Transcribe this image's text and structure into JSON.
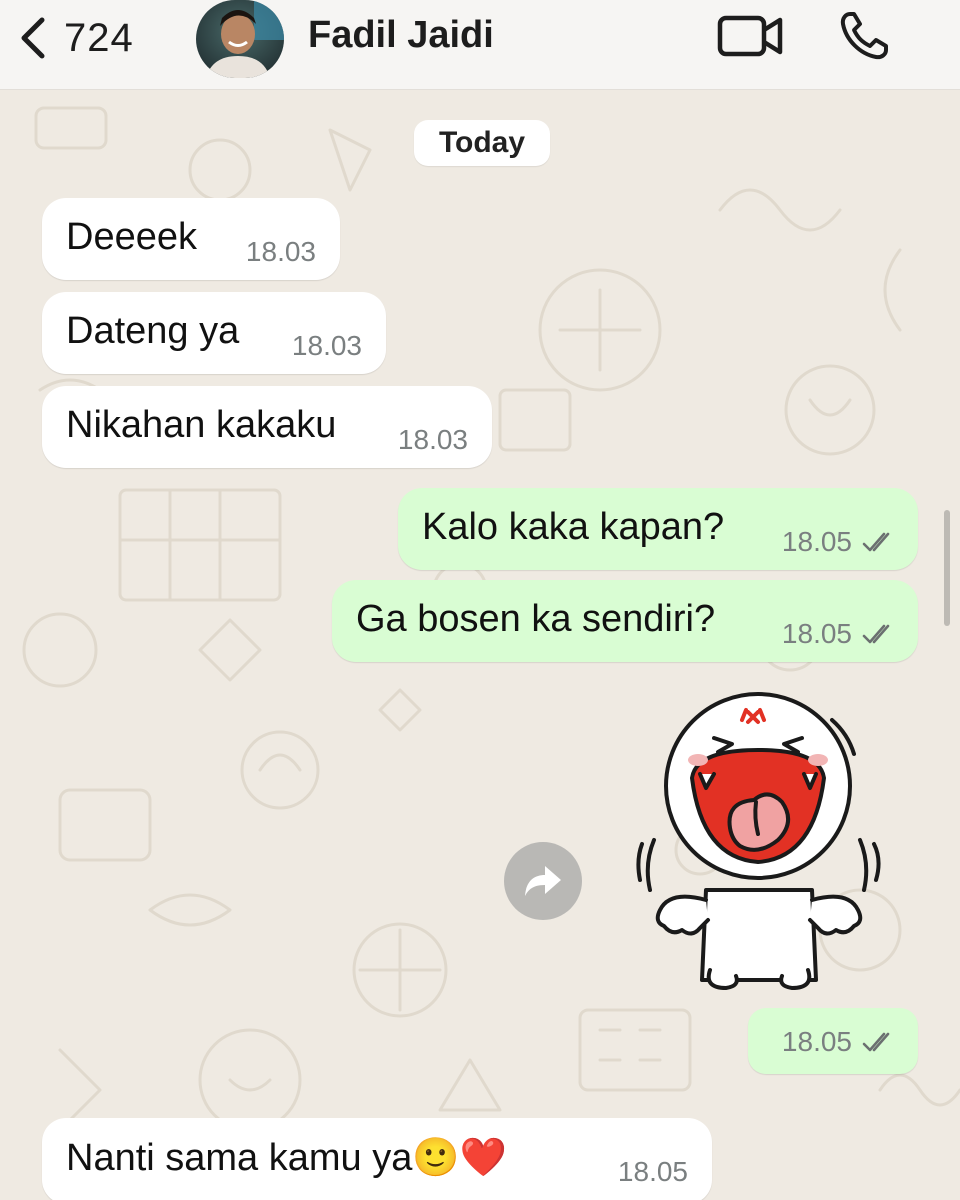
{
  "header": {
    "back_count": "724",
    "contact_name": "Fadil Jaidi",
    "icons": [
      "chevron-left-icon",
      "video-camera-icon",
      "phone-icon"
    ]
  },
  "chat": {
    "date_chip": "Today",
    "messages": [
      {
        "direction": "in",
        "text": "Deeeek",
        "time": "18.03"
      },
      {
        "direction": "in",
        "text": "Dateng ya",
        "time": "18.03"
      },
      {
        "direction": "in",
        "text": "Nikahan kakaku",
        "time": "18.03"
      },
      {
        "direction": "out",
        "text": "Kalo kaka kapan?",
        "time": "18.05",
        "status": "read"
      },
      {
        "direction": "out",
        "text": "Ga bosen ka sendiri?",
        "time": "18.05",
        "status": "read"
      },
      {
        "direction": "out",
        "type": "sticker",
        "sticker": "laughing-character-sticker",
        "time": "18.05",
        "status": "read"
      },
      {
        "direction": "in",
        "text": "Nanti sama kamu ya🙂❤️",
        "time": "18.05"
      }
    ]
  },
  "colors": {
    "incoming_bubble": "#ffffff",
    "outgoing_bubble": "#d9fdd3",
    "chat_background": "#efeae2",
    "tick_color": "#6b7070"
  }
}
